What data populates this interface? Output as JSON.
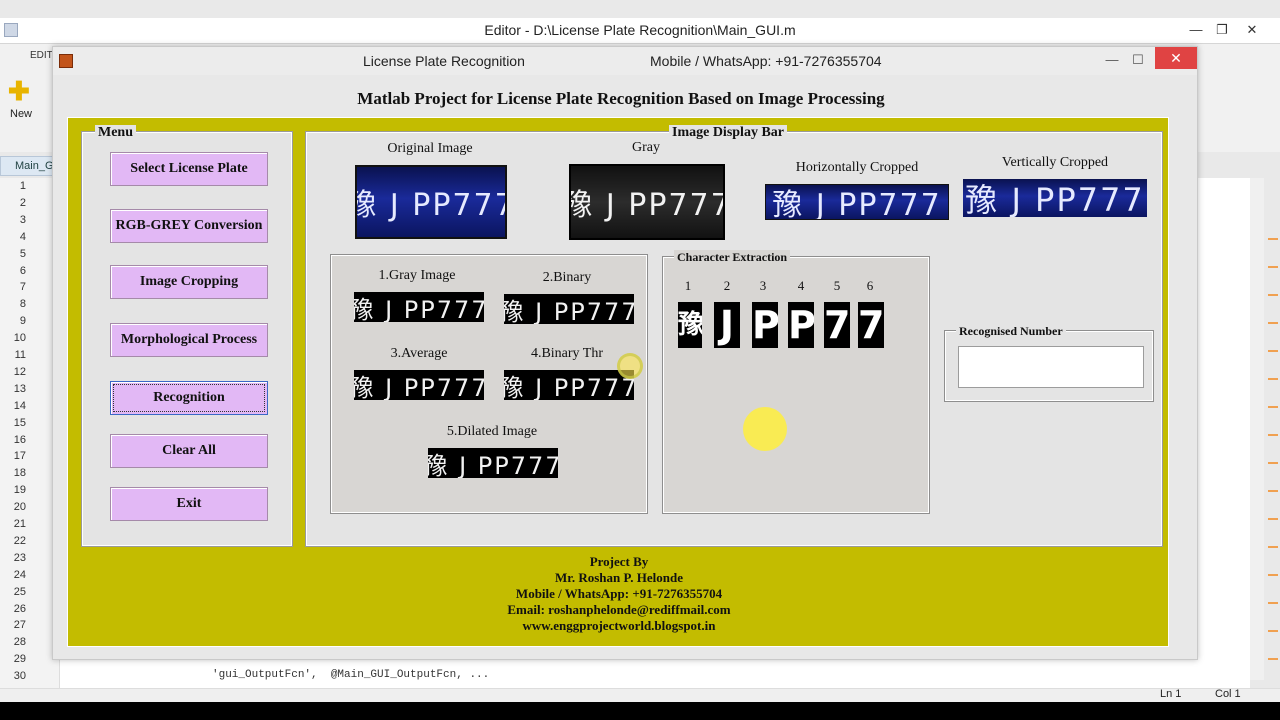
{
  "editor": {
    "title": "Editor - D:\\License Plate Recognition\\Main_GUI.m",
    "edit_tab": "EDIT",
    "new_label": "New",
    "file_tab": "Main_G",
    "line_numbers": [
      "1",
      "2",
      "3",
      "4",
      "5",
      "6",
      "7",
      "8",
      "9",
      "10",
      "11",
      "12",
      "13",
      "14",
      "15",
      "16",
      "17",
      "18",
      "19",
      "20",
      "21",
      "22",
      "23",
      "24",
      "25",
      "26",
      "27",
      "28",
      "29",
      "30"
    ],
    "code_line_30": "'gui_OutputFcn',  @Main_GUI_OutputFcn, ...",
    "status_ln": "Ln  1",
    "status_col": "Col  1",
    "min_glyph": "—",
    "max_glyph": "❐",
    "close_glyph": "✕"
  },
  "gui": {
    "title": "License Plate Recognition",
    "contact": "Mobile / WhatsApp: +91-7276355704",
    "heading": "Matlab Project for License Plate Recognition Based on Image Processing",
    "min_glyph": "—",
    "max_glyph": "☐",
    "close_glyph": "✕"
  },
  "menu": {
    "title": "Menu",
    "buttons": [
      "Select License Plate",
      "RGB-GREY Conversion",
      "Image Cropping",
      "Morphological Process",
      "Recognition",
      "Clear All",
      "Exit"
    ]
  },
  "display": {
    "title": "Image Display Bar",
    "original_caption": "Original Image",
    "gray_caption": "Gray",
    "hcrop_caption": "Horizontally Cropped",
    "vcrop_caption": "Vertically Cropped",
    "plate_text": "豫 J PP777",
    "process": {
      "gray": "1.Gray Image",
      "binary": "2.Binary",
      "average": "3.Average",
      "binary_thr": "4.Binary Thr",
      "dilated": "5.Dilated Image"
    },
    "char_extraction": {
      "title": "Character Extraction",
      "numbers": [
        "1",
        "2",
        "3",
        "4",
        "5",
        "6"
      ],
      "chars": [
        "豫",
        "J",
        "P",
        "P",
        "7",
        "7"
      ]
    },
    "recognised": {
      "title": "Recognised Number",
      "value": ""
    }
  },
  "credits": {
    "line1": "Project By",
    "line2": "Mr. Roshan P. Helonde",
    "line3": "Mobile / WhatsApp: +91-7276355704",
    "line4": "Email: roshanphelonde@rediffmail.com",
    "line5": "www.enggprojectworld.blogspot.in"
  }
}
